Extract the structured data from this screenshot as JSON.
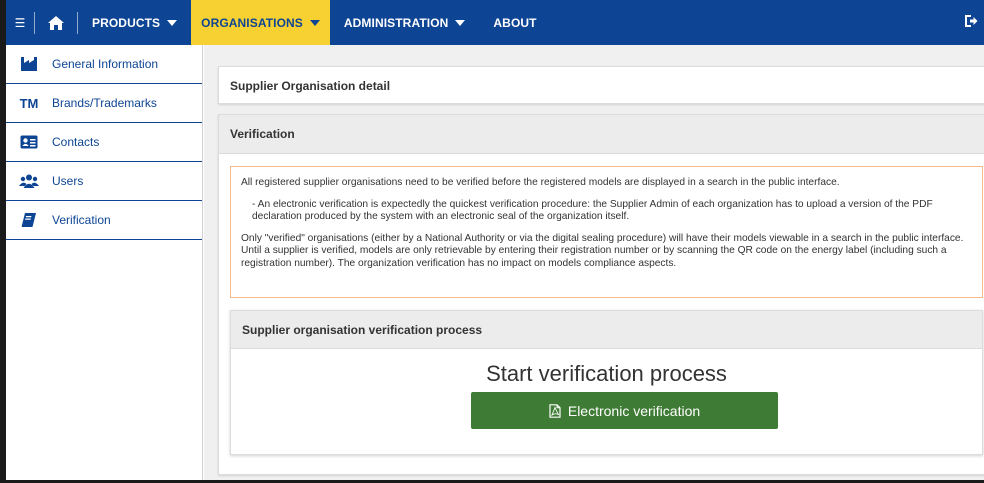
{
  "topbar": {
    "nav": [
      {
        "label": "PRODUCTS",
        "has_caret": true
      },
      {
        "label": "ORGANISATIONS",
        "has_caret": true,
        "active": true
      },
      {
        "label": "ADMINISTRATION",
        "has_caret": true
      },
      {
        "label": "ABOUT",
        "has_caret": false
      }
    ]
  },
  "sidebar": {
    "items": [
      {
        "label": "General Information",
        "icon": "factory-icon"
      },
      {
        "label": "Brands/Trademarks",
        "icon_text": "TM"
      },
      {
        "label": "Contacts",
        "icon": "contact-card-icon"
      },
      {
        "label": "Users",
        "icon": "users-icon"
      },
      {
        "label": "Verification",
        "icon": "book-icon"
      }
    ]
  },
  "main": {
    "detail_title": "Supplier Organisation detail",
    "verification_title": "Verification",
    "notice": {
      "p1": "All registered supplier organisations need to be verified before the registered models are displayed in a search in the public interface.",
      "p2": "- An electronic verification is expectedly the quickest verification procedure: the Supplier Admin of each organization has to upload a version of the PDF declaration produced by the system with an electronic seal of the organization itself.",
      "p3": "Only \"verified\" organisations (either by a National Authority or via the digital sealing procedure) will have their models viewable in a search in the public interface. Until a supplier is verified, models are only retrievable by entering their registration number or by scanning the QR code on the energy label (including such a registration number). The organization verification has no impact on models compliance aspects."
    },
    "process_title": "Supplier organisation verification process",
    "start_title": "Start verification process",
    "button_label": "Electronic verification"
  },
  "colors": {
    "primary": "#0d4594",
    "accent": "#f7d131",
    "button": "#3e7b34",
    "notice_border": "#f5b98a"
  }
}
